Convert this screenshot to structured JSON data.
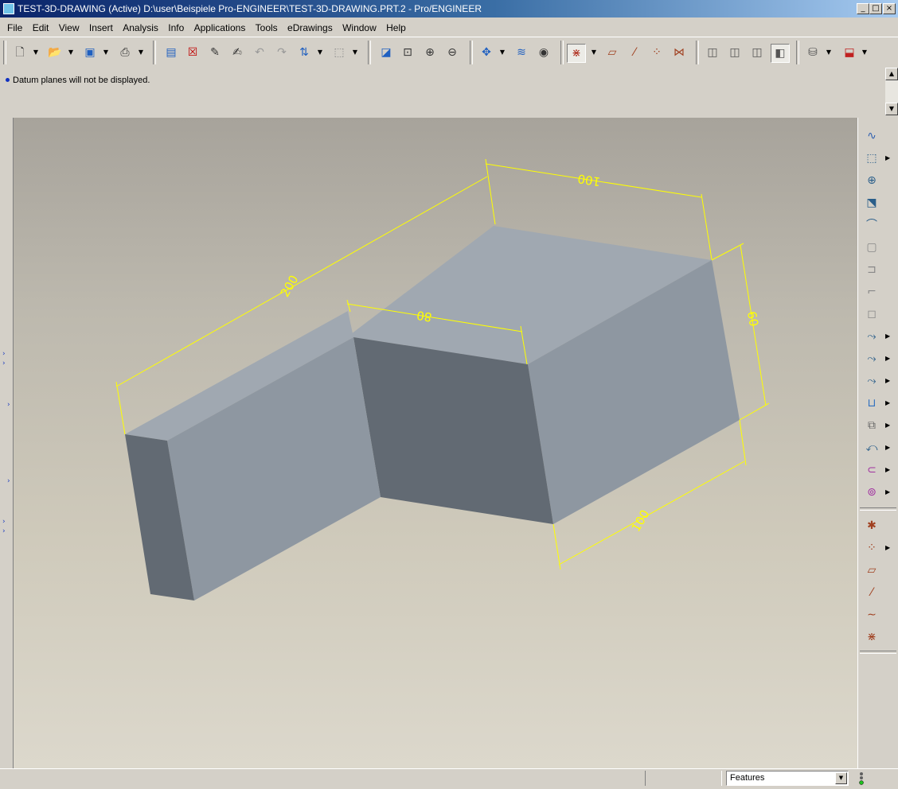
{
  "window": {
    "title": "TEST-3D-DRAWING (Active) D:\\user\\Beispiele Pro-ENGINEER\\TEST-3D-DRAWING.PRT.2 - Pro/ENGINEER",
    "minimize_glyph": "_",
    "maximize_glyph": "□",
    "close_glyph": "×"
  },
  "menu": {
    "items": [
      "File",
      "Edit",
      "View",
      "Insert",
      "Analysis",
      "Info",
      "Applications",
      "Tools",
      "eDrawings",
      "Window",
      "Help"
    ]
  },
  "toolbar": {
    "icons": [
      "new-icon",
      "open-icon",
      "save-icon",
      "print-icon",
      "window-icon",
      "close-window-icon",
      "regenerate-icon",
      "edit-icon",
      "undo-icon",
      "redo-icon",
      "relations-icon",
      "select-box-icon",
      "repaint-icon",
      "zoom-fit-icon",
      "zoom-in-icon",
      "zoom-out-icon",
      "spin-center-icon",
      "layers-icon",
      "view-manager-icon",
      "datum-points-icon",
      "datum-planes-icon",
      "datum-axes-icon",
      "point-display-icon",
      "csys-display-icon",
      "wireframe-icon",
      "hidden-line-icon",
      "no-hidden-icon",
      "shading-icon",
      "model-tree-icon",
      "analysis-icon"
    ]
  },
  "message": {
    "text": "Datum planes will not be displayed."
  },
  "model": {
    "dimensions": [
      "100",
      "200",
      "80",
      "60",
      "100"
    ],
    "dimension_color": "#ffff00",
    "top_face_color": "#a0a8b1",
    "side_face_color": "#8e97a1",
    "front_face_color": "#626a73"
  },
  "right_toolbar": {
    "icons": [
      "datum-curve-icon",
      "hole-icon",
      "shaft-icon",
      "cut-icon",
      "round-icon",
      "shell-icon",
      "rib-icon",
      "draft-icon",
      "chamfer-icon",
      "protrusion-icon",
      "sketch-icon",
      "sweep-icon",
      "blend-icon",
      "copy-icon",
      "pattern-icon",
      "mirror-icon",
      "group-icon",
      "point-icon",
      "point-array-icon",
      "plane-icon",
      "axis-icon",
      "curve-icon",
      "csys-icon"
    ]
  },
  "status": {
    "filter_value": "Features"
  }
}
